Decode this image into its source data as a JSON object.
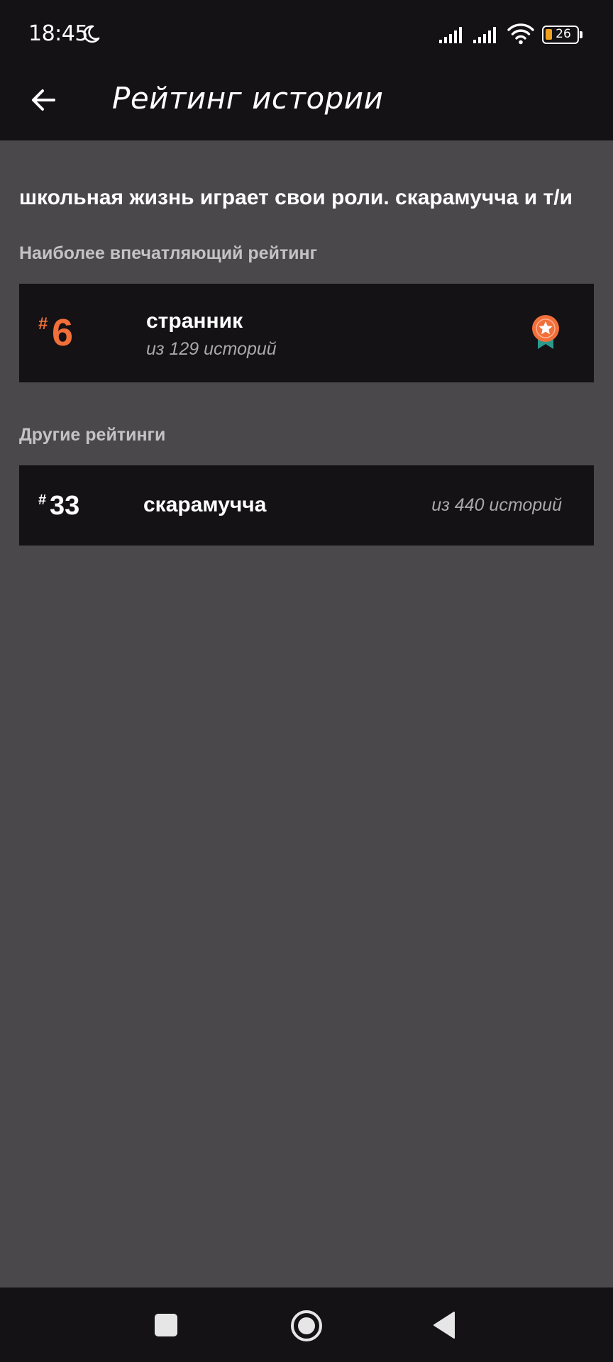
{
  "status_bar": {
    "time": "18:45",
    "battery": "26",
    "icons": [
      "moon-icon",
      "signal-icon",
      "signal-icon",
      "wifi-icon",
      "battery-icon"
    ]
  },
  "header": {
    "title": "Рейтинг истории",
    "back_icon": "arrow-left-icon"
  },
  "story": {
    "title": "школьная жизнь играет свои роли. скарамучча и т/и"
  },
  "top_rating": {
    "section_label": "Наиболее впечатляющий рейтинг",
    "hash": "#",
    "rank": "6",
    "name": "странник",
    "count": "из 129 историй",
    "badge_icon": "medal-icon"
  },
  "other_ratings": {
    "section_label": "Другие рейтинги",
    "items": [
      {
        "hash": "#",
        "rank": "33",
        "name": "скарамучча",
        "count": "из 440 историй"
      }
    ]
  },
  "nav_bar": {
    "icons": [
      "recent-apps-icon",
      "home-icon",
      "back-triangle-icon"
    ]
  },
  "colors": {
    "background": "#4a484b",
    "bar": "#141215",
    "accent": "#f26f3a",
    "ribbon": "#2a9a8e"
  }
}
